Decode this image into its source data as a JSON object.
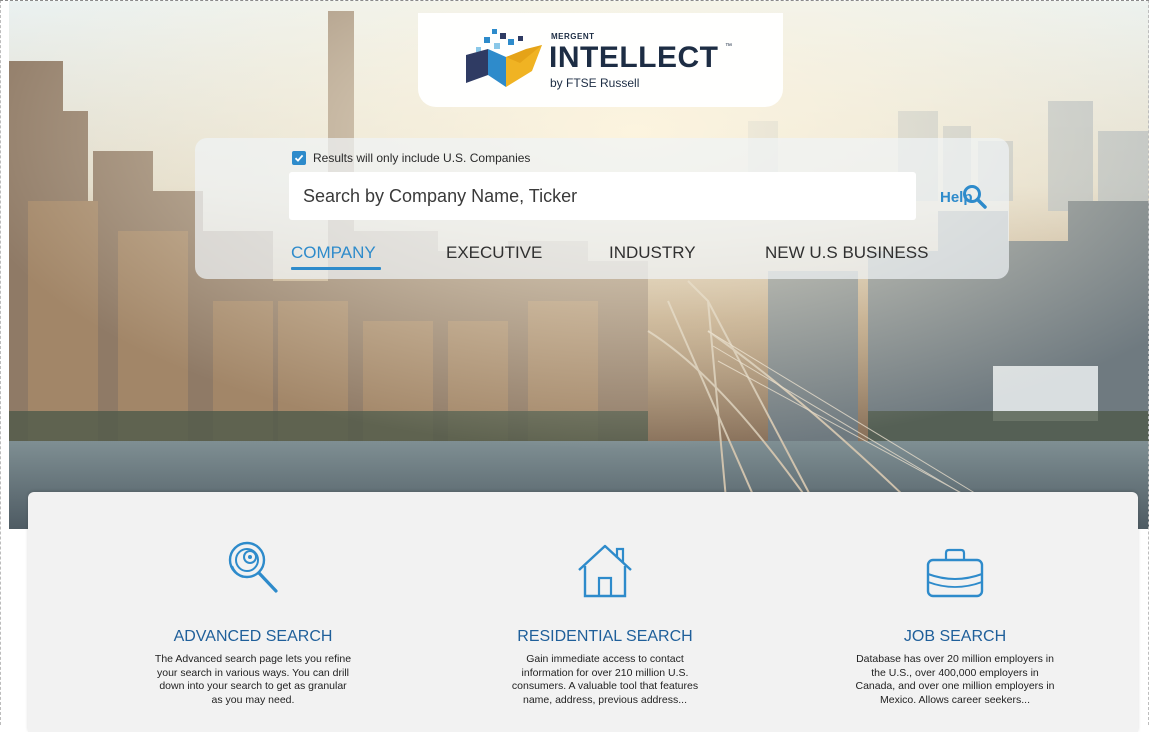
{
  "logo": {
    "small_text": "MERGENT",
    "main_text": "INTELLECT",
    "trademark": "™",
    "byline": "by FTSE Russell"
  },
  "search": {
    "us_only_checked": true,
    "us_only_label": "Results will only include U.S. Companies",
    "placeholder": "Search by Company Name, Ticker",
    "search_icon": "magnifier-icon",
    "help_label": "Help"
  },
  "tabs": [
    {
      "label": "COMPANY",
      "active": true
    },
    {
      "label": "EXECUTIVE",
      "active": false
    },
    {
      "label": "INDUSTRY",
      "active": false
    },
    {
      "label": "NEW U.S BUSINESS",
      "active": false
    }
  ],
  "features": [
    {
      "icon": "advanced-search-icon",
      "title": "ADVANCED SEARCH",
      "description": "The Advanced search page lets you refine your search in various ways. You can drill down into your search to get as granular as you may need."
    },
    {
      "icon": "house-icon",
      "title": "RESIDENTIAL SEARCH",
      "description": "Gain immediate access to contact information for over 210 million U.S. consumers. A valuable tool that features name, address, previous address..."
    },
    {
      "icon": "briefcase-icon",
      "title": "JOB SEARCH",
      "description": "Database has over 20 million employers in the U.S., over 400,000 employers in Canada, and over one million employers in Mexico. Allows career seekers..."
    }
  ],
  "colors": {
    "accent": "#2e8bcb",
    "feature_title": "#1f5f9a",
    "brand_dark": "#1d2d44",
    "panel_bg": "#f2f2f2"
  }
}
